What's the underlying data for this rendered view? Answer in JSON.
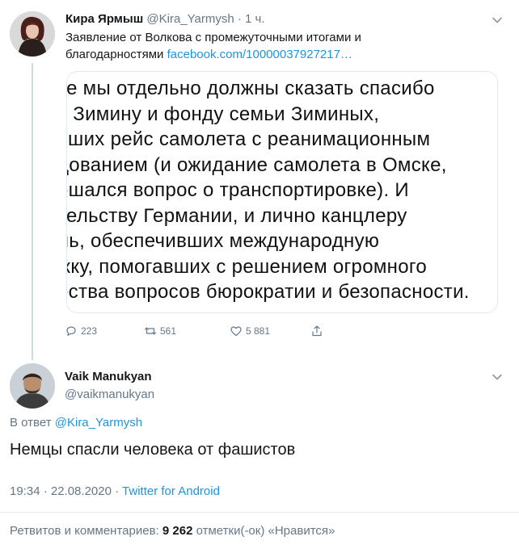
{
  "tweet1": {
    "name": "Кира Ярмыш",
    "handle": "@Kira_Yarmysh",
    "time": "· 1 ч.",
    "text": "Заявление от Волкова с промежуточными итогами и благодарностями",
    "link": "facebook.com/10000037927217…",
    "image_lines": [
      "ке мы отдельно должны сказать спасибо",
      "у Зимину и фонду семьи Зиминых,",
      "вших рейс самолета с реанимационным",
      "дованием (и ожидание самолета в Омске,",
      "ешался вопрос о транспортировке). И",
      "тельству Германии, и лично канцлеру",
      "ль, обеспечивших международную",
      "жку, помогавших с решением огромного",
      "ества вопросов бюрократии и безопасности."
    ],
    "actions": {
      "replies": "223",
      "retweets": "561",
      "likes": "5 881"
    }
  },
  "tweet2": {
    "name": "Vaik Manukyan",
    "handle": "@vaikmanukyan",
    "reply_prefix": "В ответ",
    "reply_to": "@Kira_Yarmysh",
    "text": "Немцы спасли человека от фашистов",
    "datetime": "19:34 · 22.08.2020",
    "separator": "·",
    "client": "Twitter for Android",
    "stats": {
      "label": "Ретвитов и комментариев:",
      "count": "9",
      "likes_count": "262",
      "likes_label": "отметки(-ок) «Нравится»"
    }
  },
  "colors": {
    "link": "#1b95e0",
    "muted": "#657786",
    "border": "#e1e8ed"
  }
}
